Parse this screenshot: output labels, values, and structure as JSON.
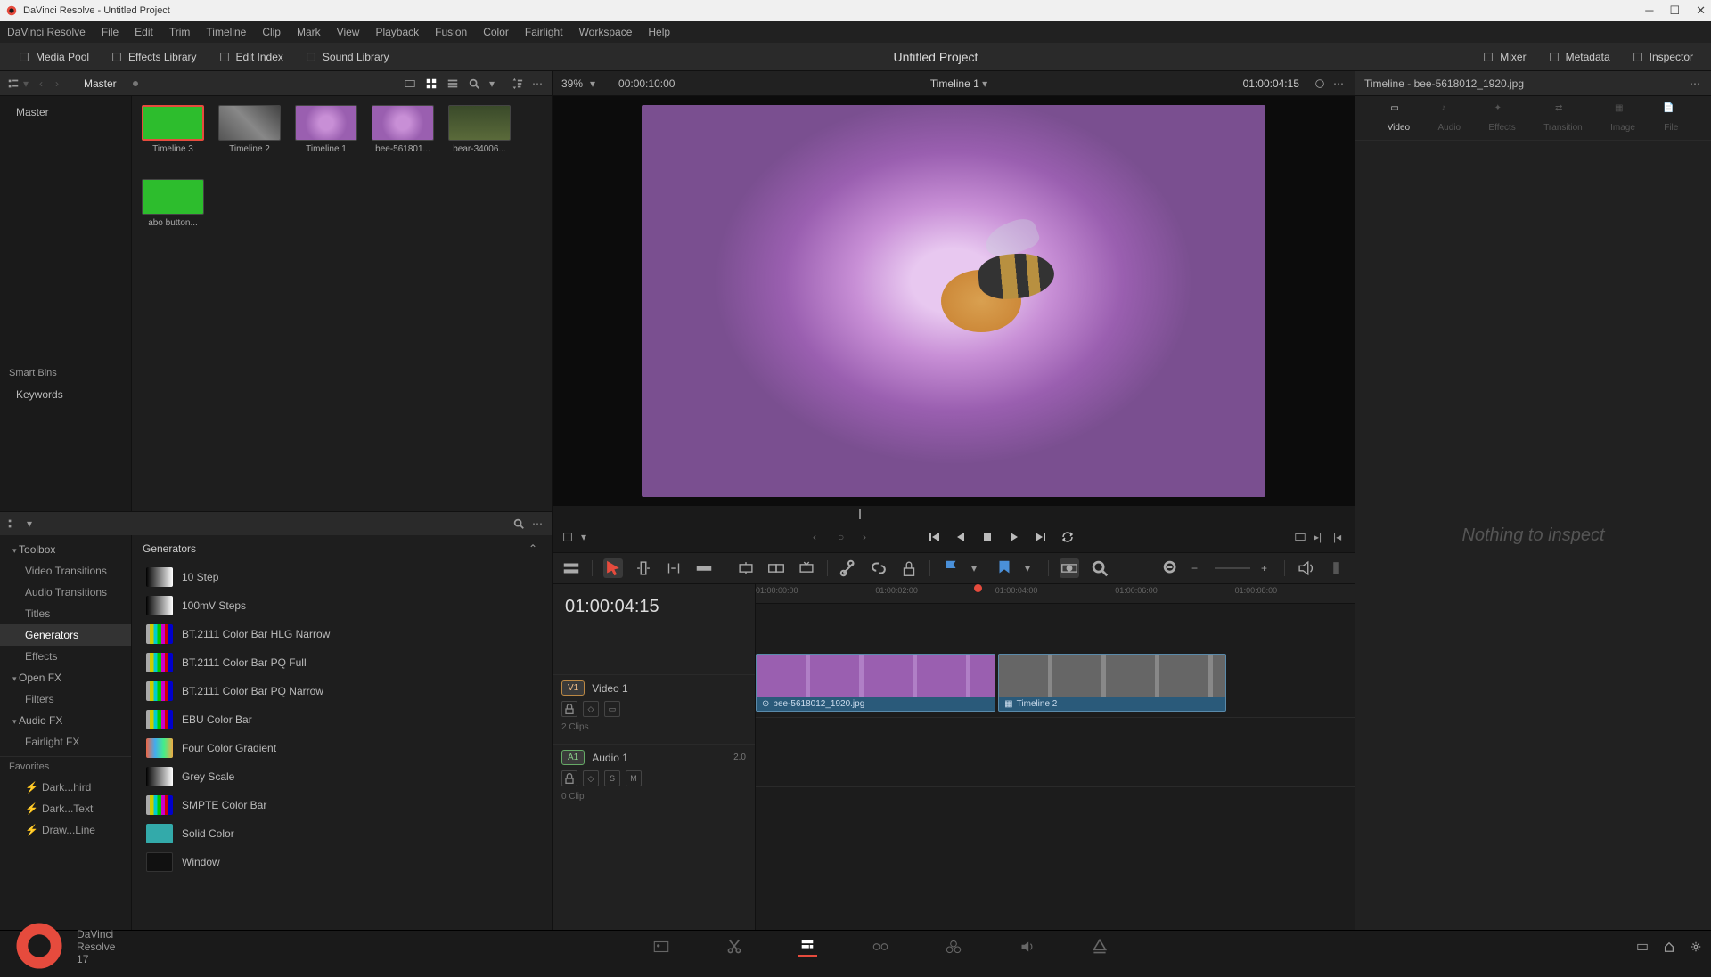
{
  "window": {
    "title": "DaVinci Resolve - Untitled Project"
  },
  "menubar": [
    "DaVinci Resolve",
    "File",
    "Edit",
    "Trim",
    "Timeline",
    "Clip",
    "Mark",
    "View",
    "Playback",
    "Fusion",
    "Color",
    "Fairlight",
    "Workspace",
    "Help"
  ],
  "workspace_tabs": {
    "left": [
      {
        "id": "media-pool",
        "label": "Media Pool"
      },
      {
        "id": "effects-library",
        "label": "Effects Library"
      },
      {
        "id": "edit-index",
        "label": "Edit Index"
      },
      {
        "id": "sound-library",
        "label": "Sound Library"
      }
    ],
    "center_title": "Untitled Project",
    "right": [
      {
        "id": "mixer",
        "label": "Mixer"
      },
      {
        "id": "metadata",
        "label": "Metadata"
      },
      {
        "id": "inspector",
        "label": "Inspector"
      }
    ]
  },
  "media_pool": {
    "bin_header": "Master",
    "bins": {
      "root": "Master",
      "smart_bins_header": "Smart Bins",
      "smart_bins": [
        "Keywords"
      ]
    },
    "clips": [
      {
        "name": "Timeline 3",
        "thumb": "green",
        "selected": true
      },
      {
        "name": "Timeline 2",
        "thumb": "bw"
      },
      {
        "name": "Timeline 1",
        "thumb": "flower"
      },
      {
        "name": "bee-561801...",
        "thumb": "flower"
      },
      {
        "name": "bear-34006...",
        "thumb": "bear"
      },
      {
        "name": "abo button...",
        "thumb": "green"
      }
    ]
  },
  "fx_panel": {
    "categories": [
      {
        "label": "Toolbox",
        "type": "open"
      },
      {
        "label": "Video Transitions",
        "type": "sub"
      },
      {
        "label": "Audio Transitions",
        "type": "sub"
      },
      {
        "label": "Titles",
        "type": "sub"
      },
      {
        "label": "Generators",
        "type": "sub sel"
      },
      {
        "label": "Effects",
        "type": "sub"
      },
      {
        "label": "Open FX",
        "type": "open"
      },
      {
        "label": "Filters",
        "type": "sub"
      },
      {
        "label": "Audio FX",
        "type": "open"
      },
      {
        "label": "Fairlight FX",
        "type": "sub"
      }
    ],
    "favorites_header": "Favorites",
    "favorites": [
      "Dark...hird",
      "Dark...Text",
      "Draw...Line"
    ],
    "list_header": "Generators",
    "items": [
      {
        "name": "10 Step",
        "swatch": "sw-gray1"
      },
      {
        "name": "100mV Steps",
        "swatch": "sw-gray1"
      },
      {
        "name": "BT.2111 Color Bar HLG Narrow",
        "swatch": "sw-bars"
      },
      {
        "name": "BT.2111 Color Bar PQ Full",
        "swatch": "sw-bars"
      },
      {
        "name": "BT.2111 Color Bar PQ Narrow",
        "swatch": "sw-bars"
      },
      {
        "name": "EBU Color Bar",
        "swatch": "sw-bars"
      },
      {
        "name": "Four Color Gradient",
        "swatch": "sw-grad"
      },
      {
        "name": "Grey Scale",
        "swatch": "sw-gray2"
      },
      {
        "name": "SMPTE Color Bar",
        "swatch": "sw-bars"
      },
      {
        "name": "Solid Color",
        "swatch": "sw-solid"
      },
      {
        "name": "Window",
        "swatch": "sw-black"
      }
    ]
  },
  "viewer": {
    "zoom": "39%",
    "duration": "00:00:10:00",
    "title": "Timeline 1",
    "timecode": "01:00:04:15"
  },
  "timeline": {
    "timecode": "01:00:04:15",
    "playhead_pct": 37,
    "ruler_ticks": [
      "01:00:00:00",
      "01:00:02:00",
      "01:00:04:00",
      "01:00:06:00",
      "01:00:08:00"
    ],
    "tracks": {
      "video": {
        "badge": "V1",
        "name": "Video 1",
        "clips_count": "2 Clips"
      },
      "audio": {
        "badge": "A1",
        "name": "Audio 1",
        "channels": "2.0",
        "clips_count": "0 Clip"
      }
    },
    "clips": [
      {
        "name": "bee-5618012_1920.jpg",
        "left": 0,
        "width": 40,
        "type": "flower",
        "icon": "clip"
      },
      {
        "name": "Timeline 2",
        "left": 40.5,
        "width": 38,
        "type": "bw",
        "icon": "compound"
      }
    ]
  },
  "inspector": {
    "header": "Timeline - bee-5618012_1920.jpg",
    "tabs": [
      "Video",
      "Audio",
      "Effects",
      "Transition",
      "Image",
      "File"
    ],
    "empty_text": "Nothing to inspect"
  },
  "footer": {
    "branding": "DaVinci Resolve 17",
    "pages": [
      "media",
      "cut",
      "edit",
      "fusion",
      "color",
      "fairlight",
      "deliver"
    ],
    "active_page": "edit"
  }
}
